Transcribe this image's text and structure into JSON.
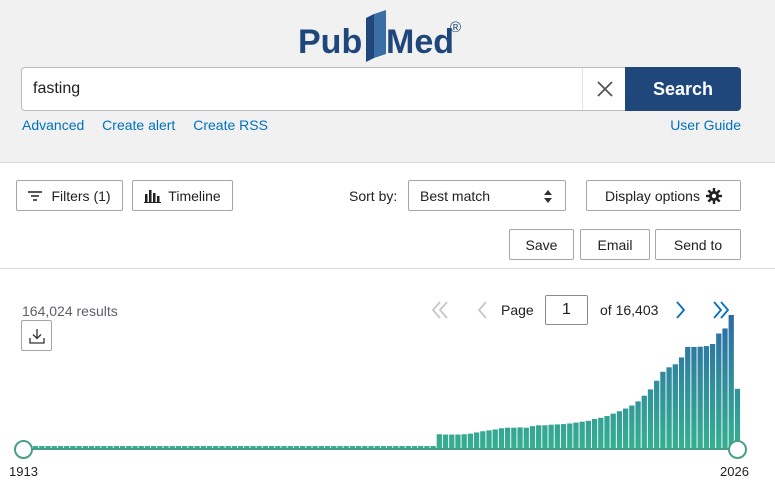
{
  "header": {
    "logo_text_left": "Pub",
    "logo_text_right": "Med",
    "logo_registered": "®",
    "search": {
      "value": "fasting",
      "placeholder": ""
    },
    "search_button": "Search",
    "links": [
      "Advanced",
      "Create alert",
      "Create RSS"
    ],
    "user_guide": "User Guide"
  },
  "toolbar": {
    "filters_label": "Filters (1)",
    "timeline_label": "Timeline",
    "sort_label": "Sort by:",
    "sort_value": "Best match",
    "display_options": "Display options",
    "save": "Save",
    "email": "Email",
    "send_to": "Send to"
  },
  "results": {
    "count": "164,024 results"
  },
  "pager": {
    "page_label": "Page",
    "page_value": "1",
    "of_label": "of 16,403"
  },
  "timeline": {
    "start_year": "1913",
    "end_year": "2026"
  },
  "colors": {
    "brand_blue": "#20477b",
    "link_blue": "#0071bc",
    "bar_teal": "#36b090",
    "bar_blue": "#2b6aa6",
    "handle_teal": "#4a9d86"
  },
  "chart_data": {
    "type": "bar",
    "x": [
      1913,
      1914,
      1915,
      1916,
      1917,
      1918,
      1919,
      1920,
      1921,
      1922,
      1923,
      1924,
      1925,
      1926,
      1927,
      1928,
      1929,
      1930,
      1931,
      1932,
      1933,
      1934,
      1935,
      1936,
      1937,
      1938,
      1939,
      1940,
      1941,
      1942,
      1943,
      1944,
      1945,
      1946,
      1947,
      1948,
      1949,
      1950,
      1951,
      1952,
      1953,
      1954,
      1955,
      1956,
      1957,
      1958,
      1959,
      1960,
      1961,
      1962,
      1963,
      1964,
      1965,
      1966,
      1967,
      1968,
      1969,
      1970,
      1971,
      1972,
      1973,
      1974,
      1975,
      1976,
      1977,
      1978,
      1979,
      1980,
      1981,
      1982,
      1983,
      1984,
      1985,
      1986,
      1987,
      1988,
      1989,
      1990,
      1991,
      1992,
      1993,
      1994,
      1995,
      1996,
      1997,
      1998,
      1999,
      2000,
      2001,
      2002,
      2003,
      2004,
      2005,
      2006,
      2007,
      2008,
      2009,
      2010,
      2011,
      2012,
      2013,
      2014,
      2015,
      2016,
      2017,
      2018,
      2019,
      2020,
      2021,
      2022,
      2023,
      2024,
      2025,
      2026
    ],
    "values": [
      30,
      30,
      30,
      30,
      30,
      30,
      30,
      30,
      30,
      30,
      30,
      30,
      30,
      30,
      30,
      30,
      30,
      30,
      30,
      30,
      30,
      30,
      30,
      30,
      30,
      30,
      30,
      30,
      30,
      30,
      30,
      30,
      30,
      30,
      30,
      30,
      30,
      30,
      30,
      30,
      30,
      30,
      30,
      30,
      30,
      30,
      30,
      30,
      30,
      30,
      30,
      30,
      30,
      30,
      30,
      30,
      30,
      30,
      30,
      30,
      35,
      40,
      45,
      50,
      55,
      460,
      450,
      450,
      450,
      460,
      480,
      520,
      560,
      590,
      620,
      660,
      680,
      680,
      690,
      680,
      730,
      760,
      760,
      780,
      790,
      800,
      820,
      850,
      880,
      910,
      970,
      1010,
      1070,
      1150,
      1230,
      1320,
      1420,
      1560,
      1750,
      1960,
      2250,
      2550,
      2700,
      2800,
      3030,
      3380,
      3380,
      3390,
      3410,
      3480,
      3830,
      4000,
      4450,
      1980
    ],
    "ylim": [
      0,
      4450
    ]
  }
}
